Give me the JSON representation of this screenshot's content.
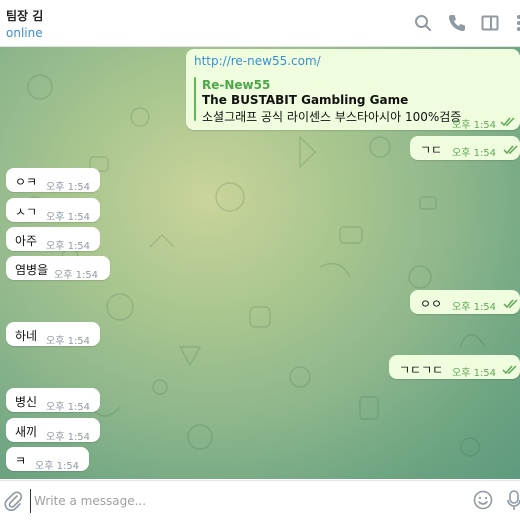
{
  "header": {
    "title": "팀장 김",
    "status": "online"
  },
  "icons": {
    "search": "search-icon",
    "call": "phone-icon",
    "sidebar": "sidebar-toggle-icon",
    "more": "more-vertical-icon",
    "attach": "paperclip-icon",
    "emoji": "smiley-icon",
    "mic": "microphone-icon"
  },
  "messages": {
    "link_msg": {
      "url": "http://re-new55.com/",
      "site": "Re-New55",
      "title": "The BUSTABIT Gambling Game",
      "desc": "소셜그래프 공식 라이센스 부스타아시아 100%검증",
      "time": "오후 1:54"
    },
    "out1": {
      "text": "ㄱㄷ",
      "time": "오후 1:54"
    },
    "in1": {
      "text": "ㅇㅋ",
      "time": "오후 1:54"
    },
    "in2": {
      "text": "ㅅㄱ",
      "time": "오후 1:54"
    },
    "in3": {
      "text": "아주",
      "time": "오후 1:54"
    },
    "in4": {
      "text": "염병을",
      "time": "오후 1:54"
    },
    "out2": {
      "text": "ㅇㅇ",
      "time": "오후 1:54"
    },
    "in5": {
      "text": "하네",
      "time": "오후 1:54"
    },
    "out3": {
      "text": "ㄱㄷㄱㄷ",
      "time": "오후 1:54"
    },
    "in6": {
      "text": "병신",
      "time": "오후 1:54"
    },
    "in7": {
      "text": "새끼",
      "time": "오후 1:54"
    },
    "in8": {
      "text": "ㅋ",
      "time": "오후 1:54"
    }
  },
  "composer": {
    "placeholder": "Write a message..."
  },
  "colors": {
    "accent": "#3a8fd1",
    "outgoing_bubble": "#effdde",
    "incoming_bubble": "#ffffff",
    "read_check": "#5fa857",
    "preview_bar": "#5fb856"
  }
}
